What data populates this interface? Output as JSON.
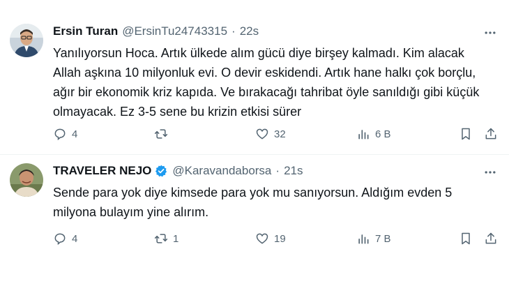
{
  "tweets": [
    {
      "name": "Ersin Turan",
      "handle": "@ErsinTu24743315",
      "sep": "·",
      "time": "22s",
      "verified": false,
      "lines": [
        "Yanılıyorsun Hoca. Artık ülkede alım gücü diye birşey kalmadı. Kim alacak",
        "Allah aşkına 10 milyonluk evi. O devir eskidendi. Artık hane halkı çok borçlu,",
        "ağır bir ekonomik kriz kapıda. Ve bırakacağı tahribat öyle sanıldığı gibi küçük",
        "olmayacak.  Ez 3-5 sene bu krizin etkisi sürer"
      ],
      "stats": {
        "replies": "4",
        "retweets": "",
        "likes": "32",
        "views": "6 B"
      }
    },
    {
      "name": "TRAVELER NEJO",
      "handle": "@Karavandaborsa",
      "sep": "·",
      "time": "21s",
      "verified": true,
      "lines": [
        "Sende para yok diye kimsede para yok mu sanıyorsun. Aldığım evden 5",
        "milyona bulayım yine alırım."
      ],
      "stats": {
        "replies": "4",
        "retweets": "1",
        "likes": "19",
        "views": "7 B"
      }
    }
  ],
  "colors": {
    "text": "#0f1419",
    "muted": "#536471",
    "verified": "#1d9bf0",
    "divider": "#eff3f4"
  },
  "icons": [
    "more-icon",
    "reply-icon",
    "retweet-icon",
    "like-icon",
    "views-icon",
    "bookmark-icon",
    "share-icon",
    "verified-icon"
  ]
}
